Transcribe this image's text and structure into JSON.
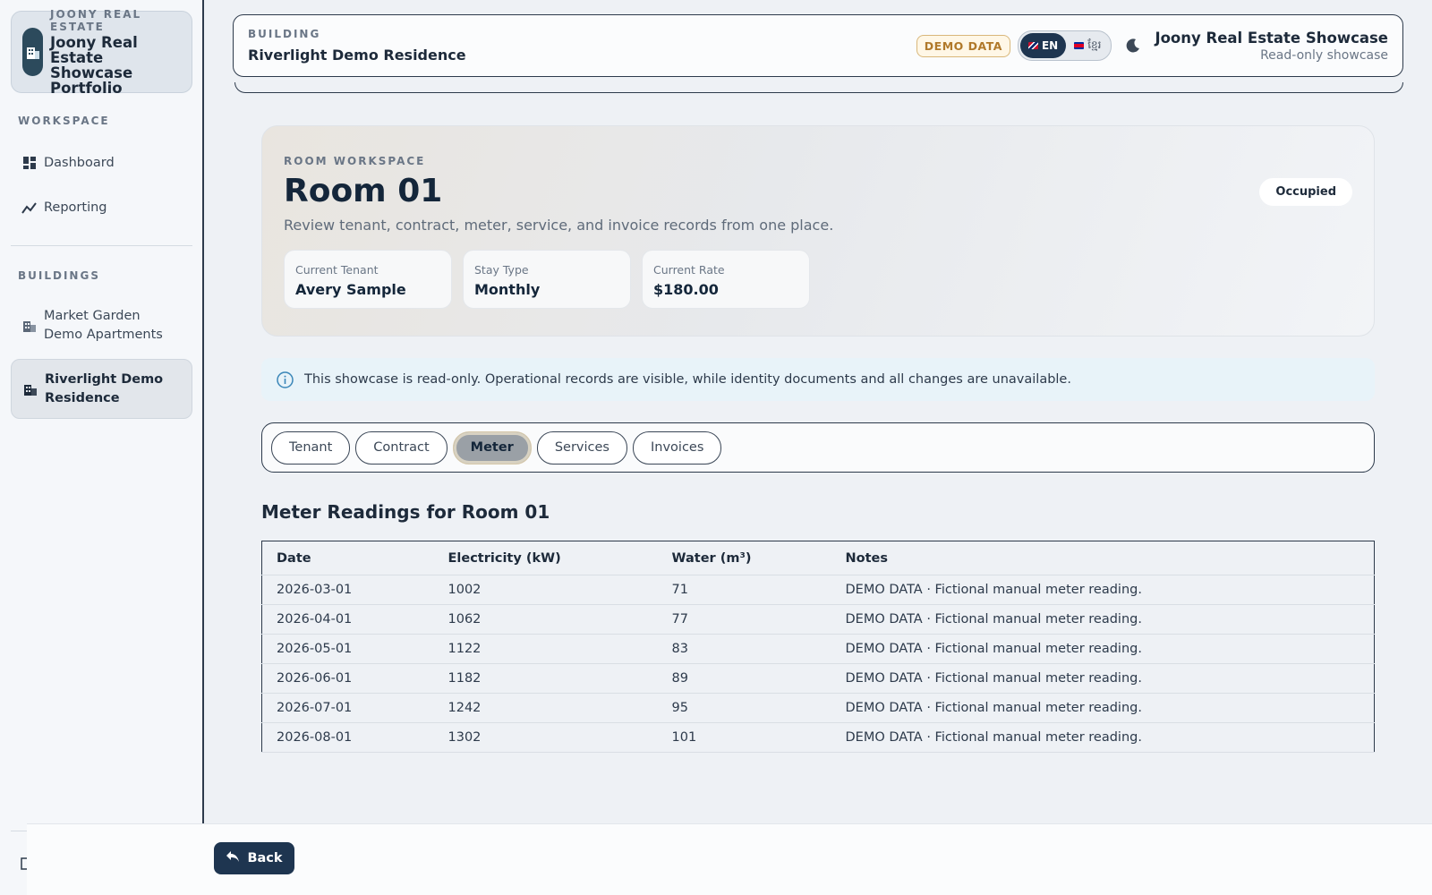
{
  "brand": {
    "kicker": "JOONY REAL ESTATE",
    "title": "Joony Real Estate Showcase Portfolio"
  },
  "sidebar": {
    "workspace_label": "WORKSPACE",
    "workspace_items": [
      {
        "label": "Dashboard",
        "icon": "dashboard-icon"
      },
      {
        "label": "Reporting",
        "icon": "chart-icon"
      }
    ],
    "buildings_label": "BUILDINGS",
    "building_items": [
      {
        "label": "Market Garden Demo Apartments",
        "icon": "building-icon",
        "active": false
      },
      {
        "label": "Riverlight Demo Residence",
        "icon": "building-icon",
        "active": true
      }
    ]
  },
  "header": {
    "kicker": "BUILDING",
    "building_name": "Riverlight Demo Residence",
    "demo_badge": "DEMO DATA",
    "lang_en": "EN",
    "lang_km": "ខ្មែរ",
    "app_title": "Joony Real Estate Showcase",
    "app_subtitle": "Read-only showcase"
  },
  "room": {
    "kicker": "ROOM WORKSPACE",
    "title": "Room 01",
    "description": "Review tenant, contract, meter, service, and invoice records from one place.",
    "status": "Occupied",
    "stats": [
      {
        "label": "Current Tenant",
        "value": "Avery Sample"
      },
      {
        "label": "Stay Type",
        "value": "Monthly"
      },
      {
        "label": "Current Rate",
        "value": "$180.00"
      }
    ]
  },
  "info_banner": "This showcase is read-only. Operational records are visible, while identity documents and all changes are unavailable.",
  "tabs": [
    {
      "label": "Tenant",
      "active": false
    },
    {
      "label": "Contract",
      "active": false
    },
    {
      "label": "Meter",
      "active": true
    },
    {
      "label": "Services",
      "active": false
    },
    {
      "label": "Invoices",
      "active": false
    }
  ],
  "meter": {
    "title": "Meter Readings for Room 01",
    "columns": [
      "Date",
      "Electricity (kW)",
      "Water (m³)",
      "Notes"
    ],
    "rows": [
      [
        "2026-03-01",
        "1002",
        "71",
        "DEMO DATA · Fictional manual meter reading."
      ],
      [
        "2026-04-01",
        "1062",
        "77",
        "DEMO DATA · Fictional manual meter reading."
      ],
      [
        "2026-05-01",
        "1122",
        "83",
        "DEMO DATA · Fictional manual meter reading."
      ],
      [
        "2026-06-01",
        "1182",
        "89",
        "DEMO DATA · Fictional manual meter reading."
      ],
      [
        "2026-07-01",
        "1242",
        "95",
        "DEMO DATA · Fictional manual meter reading."
      ],
      [
        "2026-08-01",
        "1302",
        "101",
        "DEMO DATA · Fictional manual meter reading."
      ]
    ]
  },
  "footer": {
    "back_label": "Back"
  },
  "colors": {
    "accent": "#1e3550",
    "badge": "#b0792a",
    "info_bg": "#e8f3f9"
  }
}
